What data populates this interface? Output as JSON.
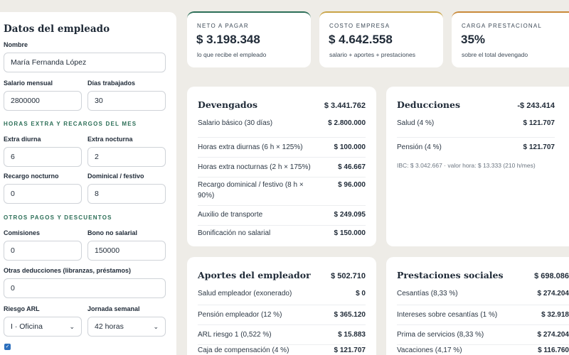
{
  "employee": {
    "title": "Datos del empleado",
    "name_label": "Nombre",
    "name_value": "María Fernanda López",
    "salary_label": "Salario mensual",
    "salary_value": "2800000",
    "days_label": "Días trabajados",
    "days_value": "30",
    "overtime_section": "HORAS EXTRA Y RECARGOS DEL MES",
    "extra_day_label": "Extra diurna",
    "extra_day_value": "6",
    "extra_night_label": "Extra nocturna",
    "extra_night_value": "2",
    "night_surcharge_label": "Recargo nocturno",
    "night_surcharge_value": "0",
    "sunday_label": "Dominical / festivo",
    "sunday_value": "8",
    "other_section": "OTROS PAGOS Y DESCUENTOS",
    "commissions_label": "Comisiones",
    "commissions_value": "0",
    "bonus_label": "Bono no salarial",
    "bonus_value": "150000",
    "other_deductions_label": "Otras deducciones (libranzas, préstamos)",
    "other_deductions_value": "0",
    "arl_label": "Riesgo ARL",
    "arl_value": "I · Oficina",
    "week_label": "Jornada semanal",
    "week_value": "42 horas",
    "checkbox_checked": true
  },
  "summary": [
    {
      "label": "NETO A PAGAR",
      "value": "$ 3.198.348",
      "sub": "lo que recibe el empleado",
      "accent": "#2c6e57"
    },
    {
      "label": "COSTO EMPRESA",
      "value": "$ 4.642.558",
      "sub": "salario + aportes + prestaciones",
      "accent": "#c9a447"
    },
    {
      "label": "CARGA PRESTACIONAL",
      "value": "35%",
      "sub": "sobre el total devengado",
      "accent": "#c98a3a"
    }
  ],
  "devengados": {
    "title": "Devengados",
    "total": "$ 3.441.762",
    "rows": [
      {
        "label": "Salario básico (30 días)",
        "amount": "$ 2.800.000"
      },
      {
        "label": "Horas extra diurnas (6 h × 125%)",
        "amount": "$ 100.000"
      },
      {
        "label": "Horas extra nocturnas (2 h × 175%)",
        "amount": "$ 46.667"
      },
      {
        "label": "Recargo dominical / festivo (8 h × 90%)",
        "amount": "$ 96.000"
      },
      {
        "label": "Auxilio de transporte",
        "amount": "$ 249.095"
      },
      {
        "label": "Bonificación no salarial",
        "amount": "$ 150.000"
      }
    ]
  },
  "deducciones": {
    "title": "Deducciones",
    "total": "-$ 243.414",
    "rows": [
      {
        "label": "Salud (4 %)",
        "amount": "$ 121.707"
      },
      {
        "label": "Pensión (4 %)",
        "amount": "$ 121.707"
      }
    ],
    "note": "IBC: $ 3.042.667 · valor hora: $ 13.333 (210 h/mes)"
  },
  "aportes": {
    "title": "Aportes del empleador",
    "total": "$ 502.710",
    "rows": [
      {
        "label": "Salud empleador (exonerado)",
        "amount": "$ 0"
      },
      {
        "label": "Pensión empleador (12 %)",
        "amount": "$ 365.120"
      },
      {
        "label": "ARL riesgo 1 (0,522 %)",
        "amount": "$ 15.883"
      },
      {
        "label": "Caja de compensación (4 %)",
        "amount": "$ 121.707"
      }
    ]
  },
  "prestaciones": {
    "title": "Prestaciones sociales",
    "total": "$ 698.086",
    "rows": [
      {
        "label": "Cesantías (8,33 %)",
        "amount": "$ 274.204"
      },
      {
        "label": "Intereses sobre cesantías (1 %)",
        "amount": "$ 32.918"
      },
      {
        "label": "Prima de servicios (8,33 %)",
        "amount": "$ 274.204"
      },
      {
        "label": "Vacaciones (4,17 %)",
        "amount": "$ 116.760"
      }
    ]
  }
}
